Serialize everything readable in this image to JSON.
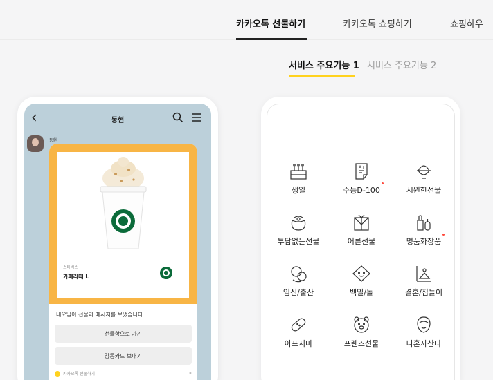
{
  "top_nav": {
    "tabs": [
      {
        "label": "카카오톡 선물하기",
        "active": true
      },
      {
        "label": "카카오톡 쇼핑하기",
        "active": false
      },
      {
        "label": "쇼핑하우",
        "active": false
      }
    ]
  },
  "sub_tabs": {
    "active": "서비스 주요기능 1",
    "inactive": "서비스 주요기능 2"
  },
  "chat": {
    "title": "동현",
    "sender": "동현",
    "gift": {
      "brand": "스타벅스",
      "name": "카페라떼 L",
      "message": "네오님이 선물과 메시지를 보냈습니다.",
      "button_primary": "선물함으로 가기",
      "button_secondary": "감동카드 보내기",
      "footer": "카카오톡 선물하기",
      "footer_arrow": ">"
    }
  },
  "categories": [
    {
      "label": "생일",
      "icon": "cake-icon",
      "new": false
    },
    {
      "label": "수능D-100",
      "icon": "exam-paper-icon",
      "new": true
    },
    {
      "label": "시원한선물",
      "icon": "shaved-ice-icon",
      "new": false
    },
    {
      "label": "부담없는선물",
      "icon": "pouch-icon",
      "new": false
    },
    {
      "label": "어른선물",
      "icon": "gift-box-icon",
      "new": false
    },
    {
      "label": "명품화장품",
      "icon": "cosmetics-icon",
      "new": true
    },
    {
      "label": "임신/출산",
      "icon": "baby-icon",
      "new": false
    },
    {
      "label": "백일/돌",
      "icon": "baby-face-icon",
      "new": false
    },
    {
      "label": "결혼/집들이",
      "icon": "house-icon",
      "new": false
    },
    {
      "label": "아프지마",
      "icon": "bandage-icon",
      "new": false
    },
    {
      "label": "프렌즈선물",
      "icon": "bear-icon",
      "new": false
    },
    {
      "label": "나혼자산다",
      "icon": "person-icon",
      "new": false
    }
  ],
  "colors": {
    "accent_yellow": "#ffd21e",
    "gift_orange": "#f8b545",
    "chat_bg": "#bcd0da",
    "starbucks_green": "#0b6b3a",
    "new_dot": "#ff4a3d"
  }
}
